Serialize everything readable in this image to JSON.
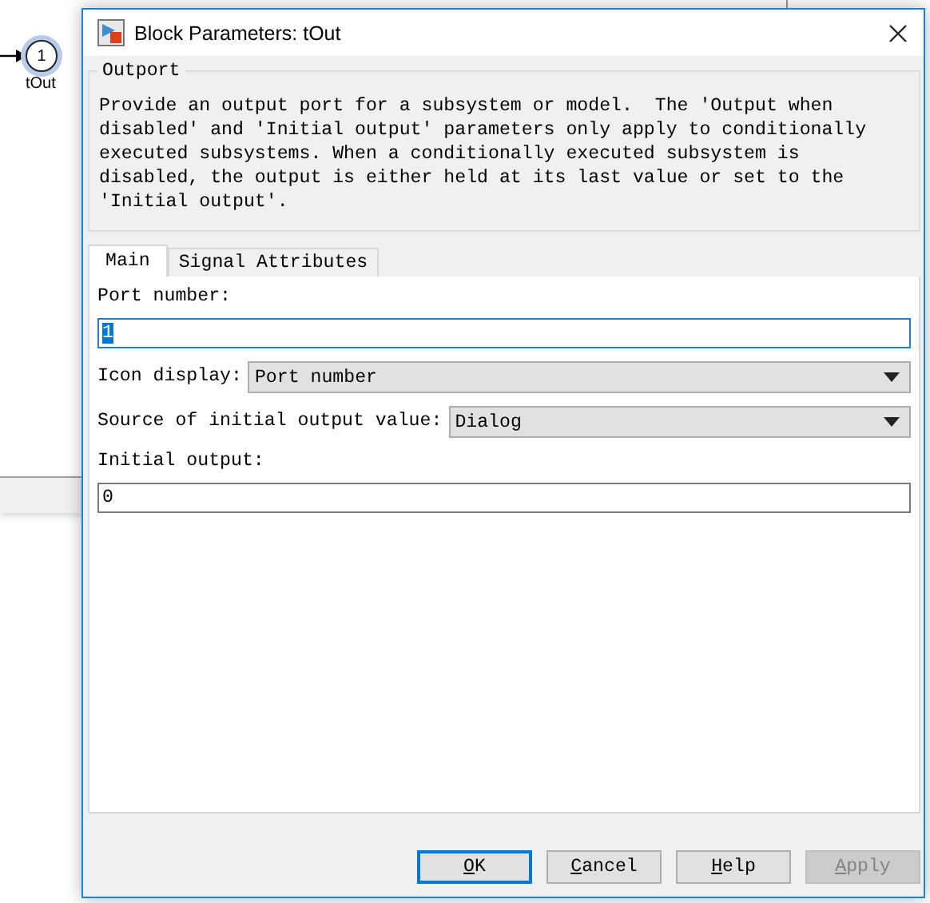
{
  "model": {
    "block": {
      "number": "1",
      "label": "tOut"
    }
  },
  "dialog": {
    "title": "Block Parameters: tOut",
    "group": {
      "title": "Outport",
      "description": "Provide an output port for a subsystem or model.  The 'Output when disabled' and 'Initial output' parameters only apply to conditionally executed subsystems. When a conditionally executed subsystem is disabled, the output is either held at its last value or set to the 'Initial output'."
    },
    "tabs": [
      {
        "label": "Main",
        "selected": true
      },
      {
        "label": "Signal Attributes",
        "selected": false
      }
    ],
    "parameters": [
      {
        "kind": "edit",
        "label": "Port number:",
        "value": "1",
        "focused": true
      },
      {
        "kind": "popup",
        "label": "Icon display:",
        "value": "Port number"
      },
      {
        "kind": "popup",
        "label": "Source of initial output value:",
        "value": "Dialog"
      },
      {
        "kind": "edit",
        "label": "Initial output:",
        "value": "0",
        "focused": false
      }
    ],
    "buttons": [
      {
        "label": "OK",
        "default": true,
        "disabled": false
      },
      {
        "label": "Cancel",
        "default": false,
        "disabled": false
      },
      {
        "label": "Help",
        "default": false,
        "disabled": false
      },
      {
        "label": "Apply",
        "default": false,
        "disabled": true
      }
    ]
  }
}
